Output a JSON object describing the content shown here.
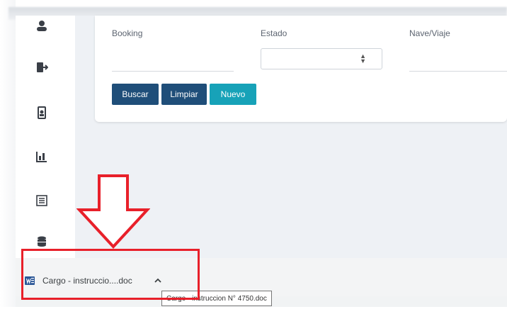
{
  "filters": {
    "booking_label": "Booking",
    "estado_label": "Estado",
    "nave_label": "Nave/Viaje",
    "estado_value": ""
  },
  "buttons": {
    "buscar": "Buscar",
    "limpiar": "Limpiar",
    "nuevo": "Nuevo"
  },
  "colors": {
    "primary_dark": "#1f4e79",
    "accent_teal": "#17a2b8",
    "annotation_red": "#e8202a"
  },
  "sidebar": {
    "icons": [
      "user-icon",
      "logout-icon",
      "document-user-icon",
      "chart-icon",
      "list-icon",
      "database-icon"
    ]
  },
  "download": {
    "file_name": "Cargo - instruccio....doc",
    "tooltip": "Cargo - instruccion N° 4750.doc",
    "icon": "word-document-icon"
  }
}
